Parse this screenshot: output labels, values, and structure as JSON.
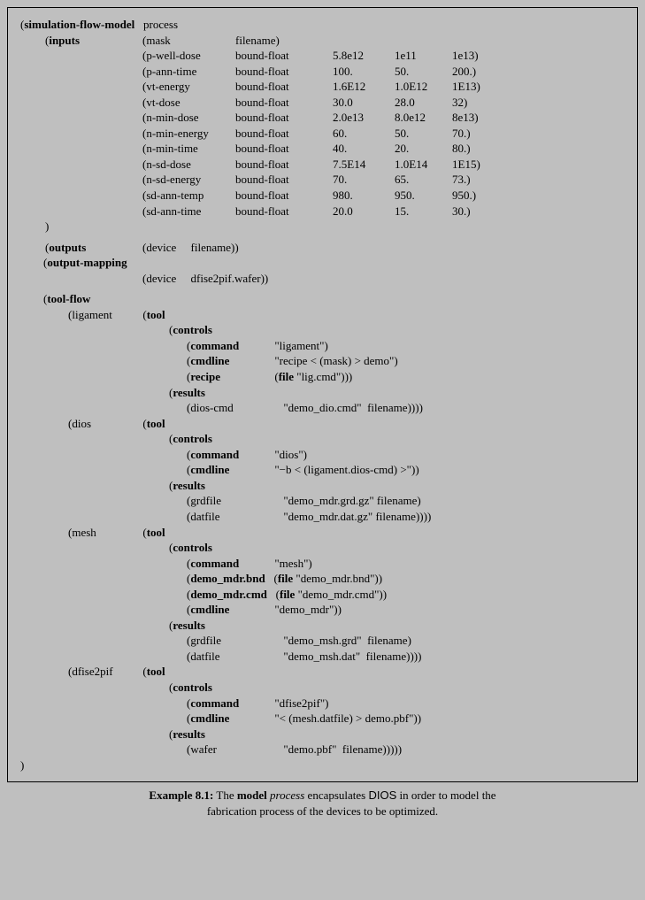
{
  "header": {
    "title": "simulation-flow-model",
    "arg": "process"
  },
  "inputs_kw": "inputs",
  "inputs": [
    {
      "name": "mask",
      "type": "filename",
      "v1": "",
      "v2": "",
      "v3": ""
    },
    {
      "name": "p-well-dose",
      "type": "bound-float",
      "v1": "5.8e12",
      "v2": "1e11",
      "v3": "1e13"
    },
    {
      "name": "p-ann-time",
      "type": "bound-float",
      "v1": "100.",
      "v2": "50.",
      "v3": "200."
    },
    {
      "name": "vt-energy",
      "type": "bound-float",
      "v1": "1.6E12",
      "v2": "1.0E12",
      "v3": "1E13"
    },
    {
      "name": "vt-dose",
      "type": "bound-float",
      "v1": "30.0",
      "v2": "28.0",
      "v3": "32"
    },
    {
      "name": "n-min-dose",
      "type": "bound-float",
      "v1": "2.0e13",
      "v2": "8.0e12",
      "v3": "8e13"
    },
    {
      "name": "n-min-energy",
      "type": "bound-float",
      "v1": "60.",
      "v2": "50.",
      "v3": "70."
    },
    {
      "name": "n-min-time",
      "type": "bound-float",
      "v1": "40.",
      "v2": "20.",
      "v3": "80."
    },
    {
      "name": "n-sd-dose",
      "type": "bound-float",
      "v1": "7.5E14",
      "v2": "1.0E14",
      "v3": "1E15"
    },
    {
      "name": "n-sd-energy",
      "type": "bound-float",
      "v1": "70.",
      "v2": "65.",
      "v3": "73."
    },
    {
      "name": "sd-ann-temp",
      "type": "bound-float",
      "v1": "980.",
      "v2": "950.",
      "v3": "950."
    },
    {
      "name": "sd-ann-time",
      "type": "bound-float",
      "v1": "20.0",
      "v2": "15.",
      "v3": "30."
    }
  ],
  "outputs_kw": "outputs",
  "outputs": {
    "name": "device",
    "type": "filename"
  },
  "outmap_kw": "output-mapping",
  "outmap": {
    "name": "device",
    "value": "dfise2pif.wafer"
  },
  "toolflow_kw": "tool-flow",
  "tool_kw": "tool",
  "controls_kw": "controls",
  "results_kw": "results",
  "file_kw": "file",
  "cmd_kw": "command",
  "cmdline_kw": "cmdline",
  "recipe_kw": "recipe",
  "tools": {
    "ligament": {
      "name": "ligament",
      "command": "\"ligament\"",
      "cmdline": "\"recipe < (mask) > demo\"",
      "recipe": "\"lig.cmd\"",
      "results": [
        {
          "k": "dios-cmd",
          "v": "\"demo_dio.cmd\"",
          "t": "filename"
        }
      ]
    },
    "dios": {
      "name": "dios",
      "command": "\"dios\"",
      "cmdline": "\"−b < (ligament.dios-cmd) >\"",
      "results": [
        {
          "k": "grdfile",
          "v": "\"demo_mdr.grd.gz\"",
          "t": "filename"
        },
        {
          "k": "datfile",
          "v": "\"demo_mdr.dat.gz\"",
          "t": "filename"
        }
      ]
    },
    "mesh": {
      "name": "mesh",
      "command": "\"mesh\"",
      "bnd_k": "demo_mdr.bnd",
      "bnd_v": "\"demo_mdr.bnd\"",
      "cmd_k": "demo_mdr.cmd",
      "cmd_v": "\"demo_mdr.cmd\"",
      "cmdline": "\"demo_mdr\"",
      "results": [
        {
          "k": "grdfile",
          "v": "\"demo_msh.grd\"",
          "t": "filename"
        },
        {
          "k": "datfile",
          "v": "\"demo_msh.dat\"",
          "t": "filename"
        }
      ]
    },
    "dfise2pif": {
      "name": "dfise2pif",
      "command": "\"dfise2pif\"",
      "cmdline": "\"< (mesh.datfile) > demo.pbf\"",
      "results": [
        {
          "k": "wafer",
          "v": "\"demo.pbf\"",
          "t": "filename"
        }
      ]
    }
  },
  "caption": {
    "label": "Example 8.1:",
    "l1a": "The ",
    "l1b": "model",
    "l1c": " process ",
    "l1d": "encapsulates ",
    "l1e": "DIOS",
    "l1f": " in order to model the",
    "l2": "fabrication process of the devices to be optimized."
  }
}
